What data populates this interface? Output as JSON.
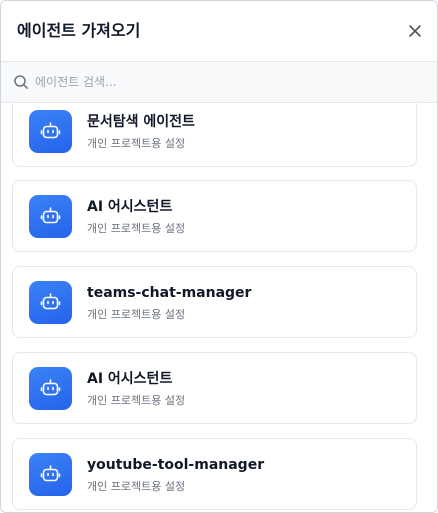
{
  "dialog": {
    "title": "에이전트 가져오기",
    "close_icon": "close-icon"
  },
  "search": {
    "placeholder": "에이전트 검색...",
    "value": "",
    "icon": "search-icon"
  },
  "agents": [
    {
      "name": "문서탐색 에이전트",
      "description": "개인 프로젝트용 설정",
      "icon": "robot-icon"
    },
    {
      "name": "AI 어시스턴트",
      "description": "개인 프로젝트용 설정",
      "icon": "robot-icon"
    },
    {
      "name": "teams-chat-manager",
      "description": "개인 프로젝트용 설정",
      "icon": "robot-icon"
    },
    {
      "name": "AI 어시스턴트",
      "description": "개인 프로젝트용 설정",
      "icon": "robot-icon"
    },
    {
      "name": "youtube-tool-manager",
      "description": "개인 프로젝트용 설정",
      "icon": "robot-icon"
    }
  ],
  "colors": {
    "accent": "#2f6ff0",
    "border": "#e5e7eb",
    "muted_text": "#6b7280"
  }
}
